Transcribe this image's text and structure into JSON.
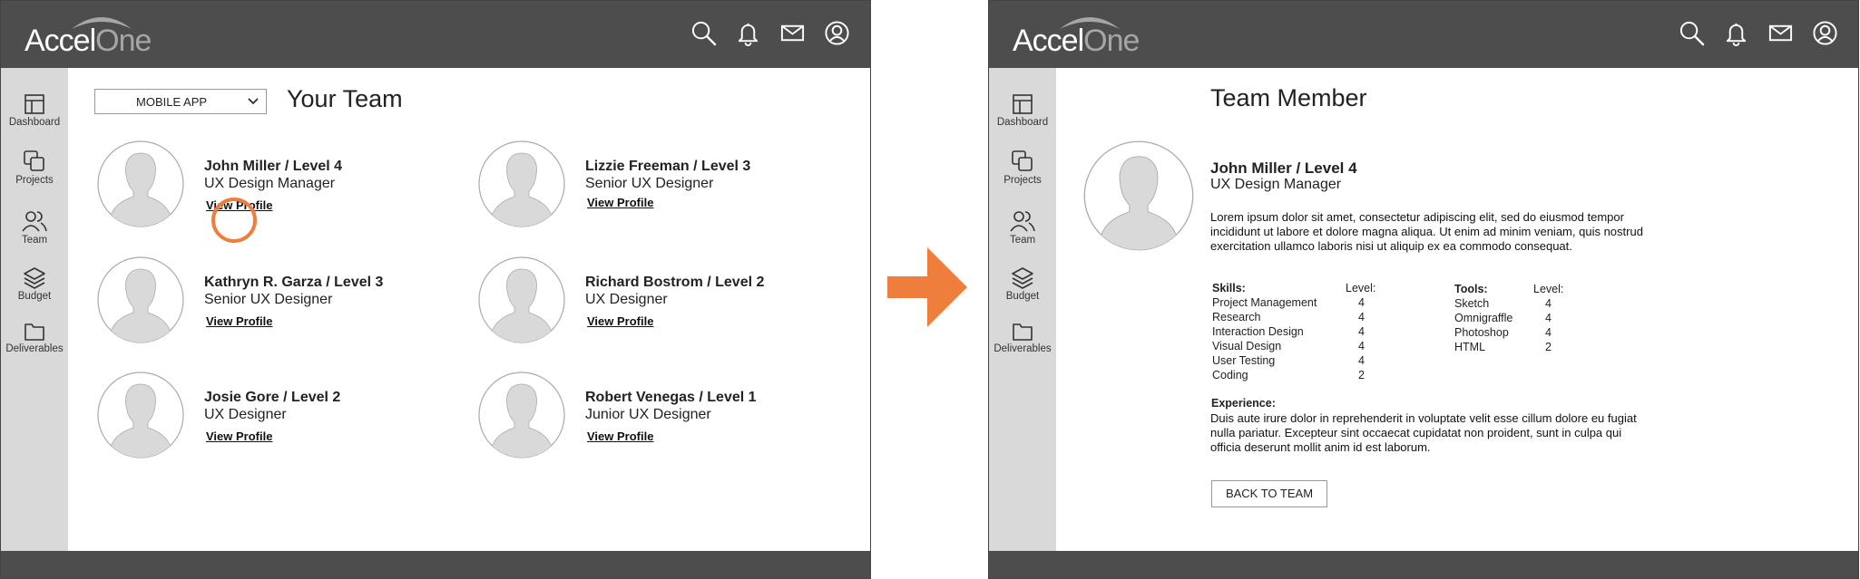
{
  "app": {
    "logo_part1": "Accel",
    "logo_part2": "One"
  },
  "colors": {
    "topbar": "#4d4d4d",
    "sidebar": "#d9d9d9",
    "accent": "#ef7d3c"
  },
  "sidebar": {
    "items": [
      {
        "label": "Dashboard",
        "icon": "dashboard-icon"
      },
      {
        "label": "Projects",
        "icon": "projects-icon"
      },
      {
        "label": "Team",
        "icon": "team-icon"
      },
      {
        "label": "Budget",
        "icon": "budget-icon"
      },
      {
        "label": "Deliverables",
        "icon": "folder-icon"
      }
    ]
  },
  "top_icons": [
    "search-icon",
    "bell-icon",
    "mail-icon",
    "user-icon"
  ],
  "team_page": {
    "dropdown_value": "MOBILE APP",
    "title": "Your Team",
    "members": [
      {
        "name": "John Miller / Level 4",
        "role": "UX Design Manager",
        "link": "View Profile"
      },
      {
        "name": "Lizzie Freeman / Level 3",
        "role": "Senior UX Designer",
        "link": "View Profile"
      },
      {
        "name": "Kathryn R. Garza / Level 3",
        "role": "Senior UX Designer",
        "link": "View Profile"
      },
      {
        "name": "Richard Bostrom / Level 2",
        "role": "UX Designer",
        "link": "View Profile"
      },
      {
        "name": "Josie Gore / Level 2",
        "role": "UX Designer",
        "link": "View Profile"
      },
      {
        "name": "Robert Venegas / Level 1",
        "role": "Junior UX Designer",
        "link": "View Profile"
      }
    ]
  },
  "member_page": {
    "title": "Team Member",
    "name": "John Miller / Level 4",
    "role": "UX Design Manager",
    "bio": "Lorem ipsum dolor sit amet, consectetur adipiscing elit, sed do eiusmod tempor incididunt ut labore et dolore magna aliqua. Ut enim ad minim veniam, quis nostrud exercitation ullamco laboris nisi ut aliquip ex ea commodo consequat.",
    "skills_header": "Skills:",
    "level_header": "Level:",
    "skills": [
      {
        "name": "Project Management",
        "level": "4"
      },
      {
        "name": "Research",
        "level": "4"
      },
      {
        "name": "Interaction Design",
        "level": "4"
      },
      {
        "name": "Visual Design",
        "level": "4"
      },
      {
        "name": "User Testing",
        "level": "4"
      },
      {
        "name": "Coding",
        "level": "2"
      }
    ],
    "tools_header": "Tools:",
    "tools": [
      {
        "name": "Sketch",
        "level": "4"
      },
      {
        "name": "Omnigraffle",
        "level": "4"
      },
      {
        "name": "Photoshop",
        "level": "4"
      },
      {
        "name": "HTML",
        "level": "2"
      }
    ],
    "experience_header": "Experience:",
    "experience": "Duis aute irure dolor in reprehenderit in voluptate velit esse cillum dolore eu fugiat nulla pariatur. Excepteur sint occaecat cupidatat non proident, sunt in culpa qui officia deserunt mollit anim id est laborum.",
    "back_button": "BACK TO TEAM"
  }
}
